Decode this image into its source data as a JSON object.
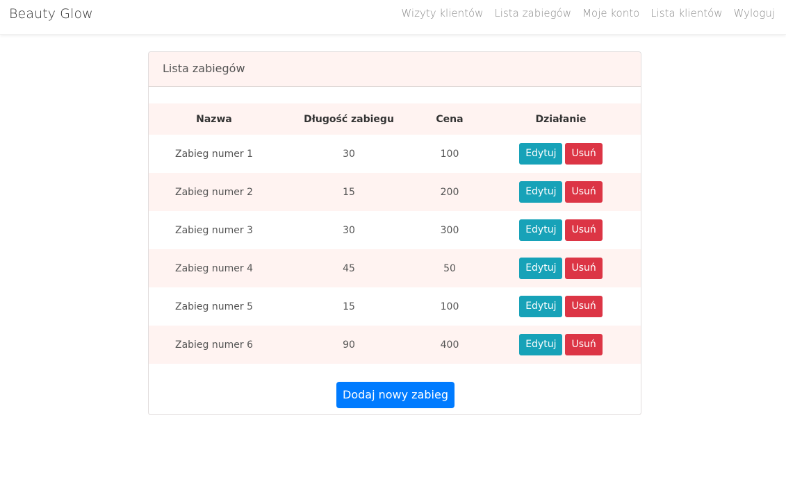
{
  "navbar": {
    "brand": "Beauty Glow",
    "links": [
      "Wizyty klientów",
      "Lista zabiegów",
      "Moje konto",
      "Lista klientów",
      "Wyloguj"
    ]
  },
  "card": {
    "title": "Lista zabiegów",
    "columns": [
      "Nazwa",
      "Długość zabiegu",
      "Cena",
      "Działanie"
    ],
    "rows": [
      {
        "name": "Zabieg numer 1",
        "duration": "30",
        "price": "100"
      },
      {
        "name": "Zabieg numer 2",
        "duration": "15",
        "price": "200"
      },
      {
        "name": "Zabieg numer 3",
        "duration": "30",
        "price": "300"
      },
      {
        "name": "Zabieg numer 4",
        "duration": "45",
        "price": "50"
      },
      {
        "name": "Zabieg numer 5",
        "duration": "15",
        "price": "100"
      },
      {
        "name": "Zabieg numer 6",
        "duration": "90",
        "price": "400"
      }
    ],
    "edit_label": "Edytuj",
    "delete_label": "Usuń",
    "add_label": "Dodaj nowy zabieg"
  },
  "colors": {
    "accent_row": "#fff3f1",
    "edit": "#17a2b8",
    "delete": "#dc3545",
    "primary": "#007bff"
  }
}
